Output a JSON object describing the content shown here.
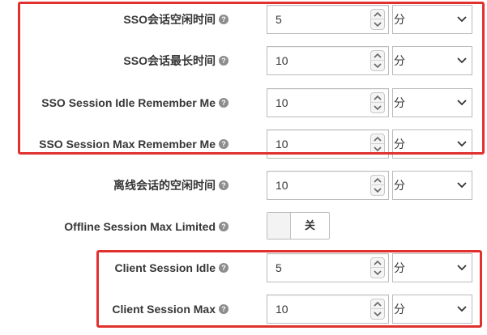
{
  "fields": [
    {
      "key": "sso-session-idle",
      "label": "SSO会话空闲时间",
      "value": "5",
      "unit": "分"
    },
    {
      "key": "sso-session-max",
      "label": "SSO会话最长时间",
      "value": "10",
      "unit": "分"
    },
    {
      "key": "sso-session-idle-remember-me",
      "label": "SSO Session Idle Remember Me",
      "value": "10",
      "unit": "分"
    },
    {
      "key": "sso-session-max-remember-me",
      "label": "SSO Session Max Remember Me",
      "value": "10",
      "unit": "分"
    },
    {
      "key": "offline-session-idle",
      "label": "离线会话的空闲时间",
      "value": "10",
      "unit": "分"
    }
  ],
  "offline_limited": {
    "label": "Offline Session Max Limited",
    "state": "关"
  },
  "client_fields": [
    {
      "key": "client-session-idle",
      "label": "Client Session Idle",
      "value": "5",
      "unit": "分"
    },
    {
      "key": "client-session-max",
      "label": "Client Session Max",
      "value": "10",
      "unit": "分"
    }
  ],
  "help_glyph": "?",
  "colors": {
    "highlight": "#e0312f",
    "border": "#bbbbbb",
    "text": "#363636",
    "help_icon": "#8b8d8f"
  }
}
